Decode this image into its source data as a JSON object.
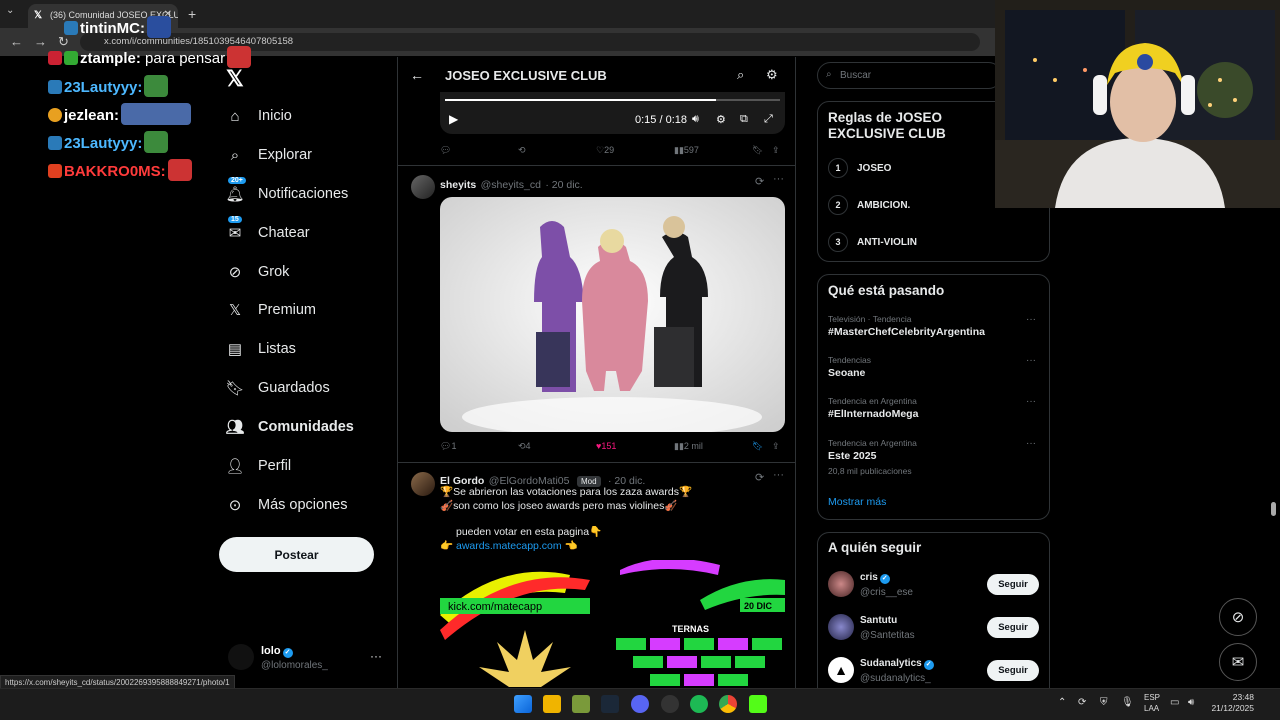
{
  "browser": {
    "tab_title": "(36) Comunidad JOSEO EXCLUSIV",
    "url": "x.com/i/communities/1851039546407805158",
    "status_url": "https://x.com/sheyits_cd/status/2002269395888849271/photo/1"
  },
  "stream_chat": [
    {
      "user": "tintinMC:",
      "text": "",
      "color": "#ffffff"
    },
    {
      "user": "ztample:",
      "text": " para pensar",
      "color": "#ffffff"
    },
    {
      "user": "23Lautyyy:",
      "text": "",
      "color": "#4db8ff"
    },
    {
      "user": "jezlean:",
      "text": "",
      "color": "#ffffff"
    },
    {
      "user": "23Lautyyy:",
      "text": "",
      "color": "#4db8ff"
    },
    {
      "user": "BAKKRO0MS:",
      "text": "",
      "color": "#ff3b3b"
    }
  ],
  "nav": {
    "items": [
      {
        "label": "Inicio",
        "icon": "home-icon"
      },
      {
        "label": "Explorar",
        "icon": "search-icon"
      },
      {
        "label": "Notificaciones",
        "icon": "bell-icon",
        "badge": "20+"
      },
      {
        "label": "Chatear",
        "icon": "mail-icon",
        "badge": "15"
      },
      {
        "label": "Grok",
        "icon": "grok-icon"
      },
      {
        "label": "Premium",
        "icon": "x-icon"
      },
      {
        "label": "Listas",
        "icon": "list-icon"
      },
      {
        "label": "Guardados",
        "icon": "bookmark-icon"
      },
      {
        "label": "Comunidades",
        "icon": "people-icon"
      },
      {
        "label": "Perfil",
        "icon": "person-icon"
      },
      {
        "label": "Más opciones",
        "icon": "more-icon"
      }
    ],
    "post_label": "Postear"
  },
  "account": {
    "name": "lolo",
    "handle": "@lolomorales_"
  },
  "community": {
    "title": "JOSEO EXCLUSIVE CLUB"
  },
  "video": {
    "time": "0:15 / 0:18",
    "progress": 0.81
  },
  "tweet0_actions": {
    "replies": "",
    "retweets": "",
    "likes": "29",
    "views": "597"
  },
  "tweet1": {
    "name": "sheyits",
    "handle": "@sheyits_cd",
    "date": "· 20 dic.",
    "replies": "1",
    "retweets": "4",
    "likes": "151",
    "views": "2 mil",
    "like_color": "#f91880",
    "bookmark_color": "#1d9bf0"
  },
  "tweet2": {
    "name": "El Gordo",
    "handle": "@ElGordoMati05",
    "mod": "Mod",
    "date": "· 20 dic.",
    "line1": "🏆Se abrieron las votaciones para los zaza awards🏆",
    "line2": "🎻son como los joseo awards pero mas violines🎻",
    "line3": "pueden votar en esta pagina👇",
    "link_prefix": "👉",
    "link": "awards.matecapp.com",
    "link_suffix": " 👈",
    "banner_url": "kick.com/matecapp",
    "banner_date": "20 DIC",
    "banner_ternas": "TERNAS"
  },
  "search": {
    "placeholder": "Buscar"
  },
  "rules": {
    "title": "Reglas de JOSEO EXCLUSIVE CLUB",
    "items": [
      {
        "n": "1",
        "label": "JOSEO"
      },
      {
        "n": "2",
        "label": "AMBICION."
      },
      {
        "n": "3",
        "label": "ANTI-VIOLIN"
      }
    ]
  },
  "trends": {
    "title": "Qué está pasando",
    "items": [
      {
        "meta": "Televisión · Tendencia",
        "name": "#MasterChefCelebrityArgentina",
        "posts": ""
      },
      {
        "meta": "Tendencias",
        "name": "Seoane",
        "posts": ""
      },
      {
        "meta": "Tendencia en Argentina",
        "name": "#ElInternadoMega",
        "posts": ""
      },
      {
        "meta": "Tendencia en Argentina",
        "name": "Este 2025",
        "posts": "20,8 mil publicaciones"
      }
    ],
    "show_more": "Mostrar más"
  },
  "follow": {
    "title": "A quién seguir",
    "button": "Seguir",
    "items": [
      {
        "name": "cris",
        "handle": "@cris__ese",
        "verified": true
      },
      {
        "name": "Santutu",
        "handle": "@Santetitas",
        "verified": false
      },
      {
        "name": "Sudanalytics",
        "handle": "@sudanalytics_",
        "verified": true
      }
    ]
  },
  "taskbar": {
    "lang_top": "ESP",
    "lang_bottom": "LAA",
    "time": "23:48",
    "date": "21/12/2025"
  }
}
